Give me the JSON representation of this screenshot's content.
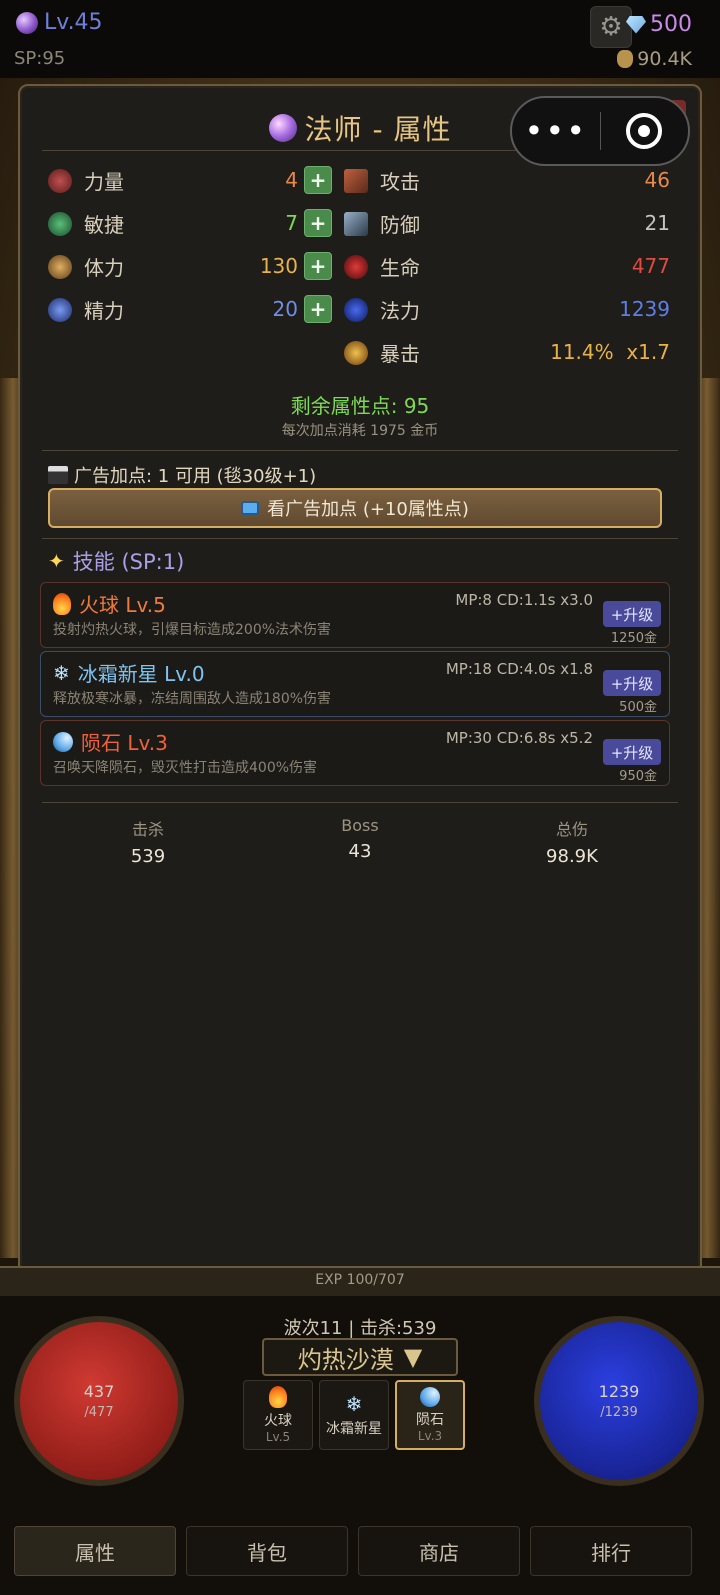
{
  "hud": {
    "level": "Lv.45",
    "sp": "SP:95",
    "gems": "500",
    "gold": "90.4K"
  },
  "panel": {
    "title": "法师 - 属性",
    "close": "X",
    "primary_stats": [
      {
        "label": "力量",
        "value": "4",
        "color": "#e8894a"
      },
      {
        "label": "敏捷",
        "value": "7",
        "color": "#7ed957"
      },
      {
        "label": "体力",
        "value": "130",
        "color": "#e8b24a"
      },
      {
        "label": "精力",
        "value": "20",
        "color": "#6f8fe6"
      }
    ],
    "plus_label": "+",
    "derived_stats": [
      {
        "label": "攻击",
        "value": "46",
        "color": "#e8894a"
      },
      {
        "label": "防御",
        "value": "21",
        "color": "#c8c4bc"
      },
      {
        "label": "生命",
        "value": "477",
        "color": "#e04a40"
      },
      {
        "label": "法力",
        "value": "1239",
        "color": "#5f7fe8"
      },
      {
        "label": "暴击",
        "value": "11.4%  x1.7",
        "color": "#e8b24a"
      }
    ],
    "remaining_points": "剩余属性点: 95",
    "cost_note": "每次加点消耗 1975 金币",
    "ad_line": "广告加点: 1 可用 (毯30级+1)",
    "ad_button": "看广告加点 (+10属性点)",
    "skills_header": "技能 (SP:1)",
    "skills": [
      {
        "name": "火球 Lv.5",
        "stats": "MP:8 CD:1.1s x3.0",
        "desc": "投射灼热火球，引爆目标造成200%法术伤害",
        "upgrade": "+升级",
        "cost": "1250金",
        "color": "#f07a3a"
      },
      {
        "name": "冰霜新星 Lv.0",
        "stats": "MP:18 CD:4.0s x1.8",
        "desc": "释放极寒冰暴，冻结周围敌人造成180%伤害",
        "upgrade": "+升级",
        "cost": "500金",
        "color": "#7fc4f0"
      },
      {
        "name": "陨石 Lv.3",
        "stats": "MP:30 CD:6.8s x5.2",
        "desc": "召唤天降陨石，毁灭性打击造成400%伤害",
        "upgrade": "+升级",
        "cost": "950金",
        "color": "#f0603a"
      }
    ],
    "summary": [
      {
        "label": "击杀",
        "value": "539"
      },
      {
        "label": "Boss",
        "value": "43"
      },
      {
        "label": "总伤",
        "value": "98.9K"
      }
    ]
  },
  "capsule": {
    "more": "•••"
  },
  "bottom": {
    "exp": "EXP 100/707",
    "hp_current": "437",
    "hp_max": "/477",
    "mp_current": "1239",
    "mp_max": "/1239",
    "wave": "波次11 | 击杀:539",
    "zone": "灼热沙漠",
    "zone_arrow": "▼",
    "skill_slots": [
      {
        "name": "火球",
        "level": "Lv.5"
      },
      {
        "name": "冰霜新星",
        "level": ""
      },
      {
        "name": "陨石",
        "level": "Lv.3"
      }
    ]
  },
  "tabs": [
    "属性",
    "背包",
    "商店",
    "排行"
  ]
}
